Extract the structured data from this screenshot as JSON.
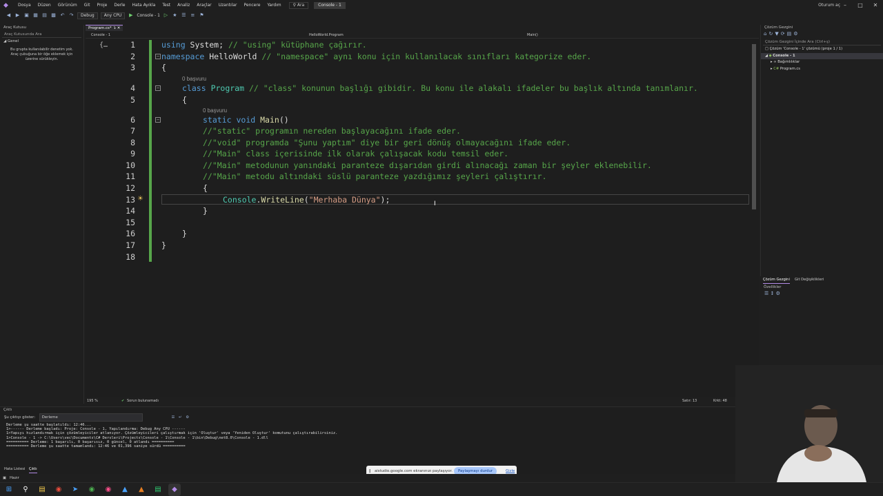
{
  "menu": {
    "items": [
      "Dosya",
      "Düzen",
      "Görünüm",
      "Git",
      "Proje",
      "Derle",
      "Hata Ayıkla",
      "Test",
      "Analiz",
      "Araçlar",
      "Uzantılar",
      "Pencere",
      "Yardım"
    ],
    "search_label": "Ara",
    "app_title": "Console - 1",
    "signin": "Oturum aç"
  },
  "toolbar": {
    "config": "Debug",
    "platform": "Any CPU",
    "run_target": "Console - 1"
  },
  "toolbox": {
    "title": "Araç Kutusu",
    "search_placeholder": "Araç Kutusunda Ara",
    "group": "Genel",
    "message": "Bu grupta kullanılabilir denetim yok. Araç çubuğuna bir öğe eklemek için üzerine sürükleyin."
  },
  "editor": {
    "tab_label": "Program.cs*",
    "project_dropdown": "Console - 1",
    "class_dropdown": "HelloWorld.Program",
    "member_dropdown": "Main()",
    "reference_hint": "0 başvuru",
    "zoom": "195 %",
    "issues": "Sorun bulunamadı",
    "line_label": "Satır: 13",
    "char_label": "Krkt: 48",
    "lines": [
      {
        "n": "1",
        "text": "using System; // \"using\" kütüphane çağırır."
      },
      {
        "n": "2",
        "text": "namespace HelloWorld // \"namespace\" aynı konu için kullanılacak sınıfları kategorize eder."
      },
      {
        "n": "3",
        "text": "{"
      },
      {
        "n": "4",
        "text": "class Program // \"class\" konunun başlığı gibidir. Bu konu ile alakalı ifadeler bu başlık altında tanımlanır."
      },
      {
        "n": "5",
        "text": "{"
      },
      {
        "n": "6",
        "text": "static void Main()"
      },
      {
        "n": "7",
        "text": "//\"static\" programın nereden başlayacağını ifade eder."
      },
      {
        "n": "8",
        "text": "//\"void\" programda \"Şunu yaptım\" diye bir geri dönüş olmayacağını ifade eder."
      },
      {
        "n": "9",
        "text": "//\"Main\" class içerisinde ilk olarak çalışacak kodu temsil eder."
      },
      {
        "n": "10",
        "text": "//\"Main\" metodunun yanındaki paranteze dışarıdan girdi alınacağı zaman bir şeyler eklenebilir."
      },
      {
        "n": "11",
        "text": "//\"Main\" metodu altındaki süslü paranteze yazdığımız şeyleri çalıştırır."
      },
      {
        "n": "12",
        "text": "{"
      },
      {
        "n": "13",
        "text": "Console.WriteLine(\"Merhaba Dünya\");"
      },
      {
        "n": "14",
        "text": "}"
      },
      {
        "n": "15",
        "text": ""
      },
      {
        "n": "16",
        "text": "}"
      },
      {
        "n": "17",
        "text": "}"
      },
      {
        "n": "18",
        "text": ""
      }
    ]
  },
  "solution_explorer": {
    "title": "Çözüm Gezgini",
    "search_placeholder": "Çözüm Gezgini İçinde Ara (Ctrl+ş)",
    "solution_node": "Çözüm 'Console - 1' çözümü (proje 1 / 1)",
    "project_node": "Console - 1",
    "deps_node": "Bağımlılıklar",
    "file_node": "Program.cs",
    "tab_solution": "Çözüm Gezgini",
    "tab_git": "Git Değişiklikleri",
    "properties_title": "Özellikler"
  },
  "output": {
    "title": "Çıktı",
    "source_label": "Şu çıktıyı göster:",
    "source_value": "Derleme",
    "lines": [
      "Derleme şu saatte başlatıldı: 12:46...",
      "1>------ Derleme başladı: Proje: Console - 1, Yapılandırma: Debug Any CPU ------",
      "1>Yapıyı hızlandırmak için çözümleyiciler atlanıyor. Çözümleyicileri çalıştırmak için 'Oluştur' veya 'Yeniden Oluştur' komutunu çalıştırabilirsiniz.",
      "1>Console - 1 -> C:\\Users\\vec\\Documents\\C# Dersleri\\Projects\\Console - 1\\Console - 1\\bin\\Debug\\net8.0\\Console - 1.dll",
      "========== Derleme: 1 başarılı, 0 başarısız, 0 güncel, 0 atlandı ==========",
      "========== Derleme şu saatte tamamlandı: 12:46 ve 01,396 saniye sürdü =========="
    ],
    "tab_errors": "Hata Listesi",
    "tab_output": "Çıktı"
  },
  "status": {
    "ready": "Hazır"
  },
  "share_bar": {
    "message": "aistudio.google.com ekranınızı paylaşıyor.",
    "stop": "Paylaşmayı durdur",
    "hide": "Gizle"
  },
  "colors": {
    "accent": "#b48ce8",
    "keyword": "#569cd6",
    "type": "#4ec9b0",
    "comment": "#57a64a",
    "string": "#d69d85",
    "method": "#dcdcaa"
  }
}
